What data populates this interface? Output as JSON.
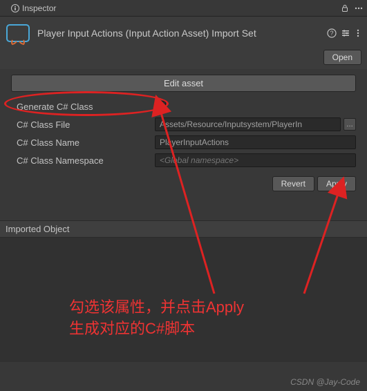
{
  "tab": {
    "label": "Inspector"
  },
  "header": {
    "title": "Player Input Actions (Input Action Asset) Import Set",
    "open_label": "Open"
  },
  "panel": {
    "edit_label": "Edit asset",
    "generate_label": "Generate C# Class",
    "generate_checked": true,
    "class_file_label": "C# Class File",
    "class_file_value": "Assets/Resource/Inputsystem/PlayerIn",
    "class_name_label": "C# Class Name",
    "class_name_value": "PlayerInputActions",
    "class_ns_label": "C# Class Namespace",
    "class_ns_placeholder": "<Global namespace>",
    "revert_label": "Revert",
    "apply_label": "Apply"
  },
  "section": {
    "imported_label": "Imported Object"
  },
  "annotation": {
    "text": "勾选该属性，并点击Apply\n生成对应的C#脚本"
  },
  "watermark": "CSDN @Jay-Code"
}
